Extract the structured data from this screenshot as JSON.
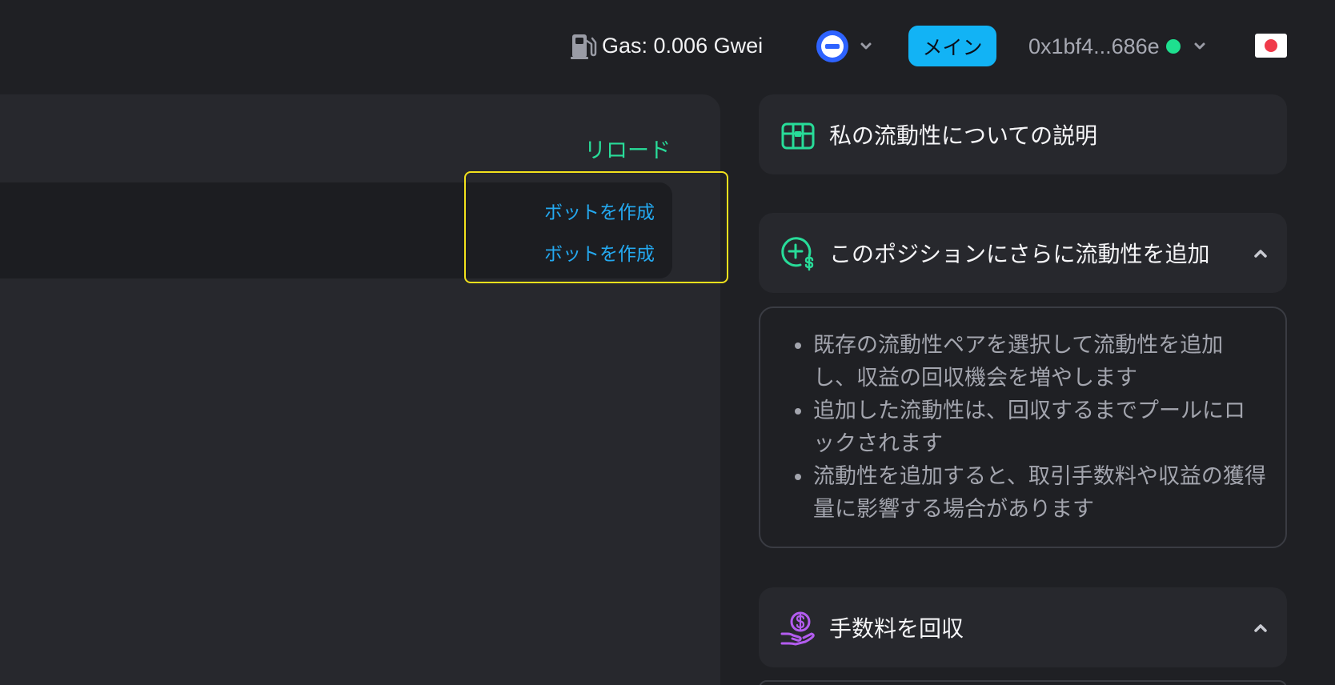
{
  "header": {
    "gas_label": "Gas: 0.006 Gwei",
    "network_button": "network-selector",
    "main_badge": "メイン",
    "address": "0x1bf4...686e",
    "status_color": "#1ee08f",
    "flag": "japan-flag"
  },
  "left_panel": {
    "reload_label": "リロード",
    "bot_links": [
      "ボットを作成",
      "ボットを作成"
    ]
  },
  "right_panel": {
    "info_card": {
      "title": "私の流動性についての説明",
      "icon": "treasure-chest-icon"
    },
    "add_card": {
      "title": "このポジションにさらに流動性を追加",
      "icon": "plus-coin-icon",
      "bullets": [
        "既存の流動性ペアを選択して流動性を追加し、収益の回収機会を増やします",
        "追加した流動性は、回収するまでプールにロックされます",
        "流動性を追加すると、取引手数料や収益の獲得量に影響する場合があります"
      ]
    },
    "fee_card": {
      "title": "手数料を回収",
      "icon": "hand-coin-icon"
    }
  },
  "colors": {
    "accent_green": "#28dc99",
    "link_blue": "#24a9f0",
    "badge_blue": "#12b3f5",
    "highlight_yellow": "#f2e11c",
    "fee_purple": "#b35cf0"
  }
}
